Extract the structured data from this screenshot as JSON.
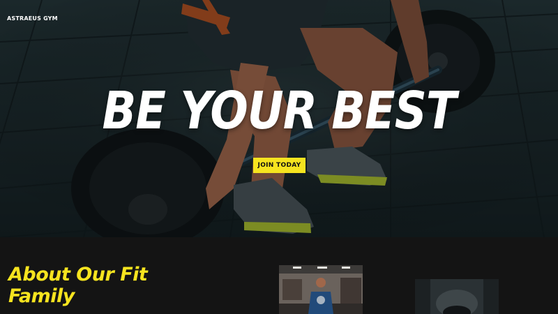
{
  "header": {
    "brand": "ASTRAEUS GYM"
  },
  "hero": {
    "headline": "BE YOUR BEST",
    "cta_label": "JOIN TODAY"
  },
  "about": {
    "title": "About Our Fit Family"
  },
  "colors": {
    "accent": "#f6e41f",
    "hero_overlay": "#1f2a2d",
    "section_bg": "#141414"
  }
}
